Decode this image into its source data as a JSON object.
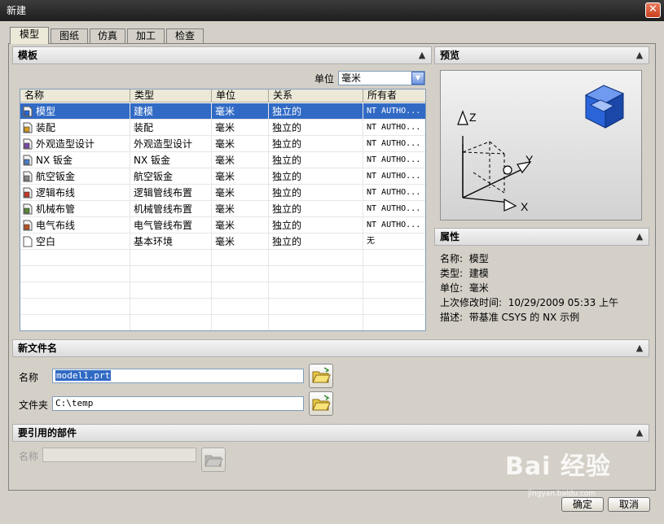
{
  "window": {
    "title": "新建",
    "close_symbol": "✕"
  },
  "tabs": [
    {
      "label": "模型",
      "active": true
    },
    {
      "label": "图纸",
      "active": false
    },
    {
      "label": "仿真",
      "active": false
    },
    {
      "label": "加工",
      "active": false
    },
    {
      "label": "检查",
      "active": false
    }
  ],
  "template": {
    "header": "模板",
    "unit_label": "单位",
    "unit_value": "毫米",
    "columns": [
      "名称",
      "类型",
      "单位",
      "关系",
      "所有者"
    ],
    "rows": [
      {
        "name": "模型",
        "type": "建模",
        "unit": "毫米",
        "relation": "独立的",
        "owner": "NT AUTHO...",
        "icon": "model-icon",
        "selected": true
      },
      {
        "name": "装配",
        "type": "装配",
        "unit": "毫米",
        "relation": "独立的",
        "owner": "NT AUTHO...",
        "icon": "assembly-icon",
        "selected": false
      },
      {
        "name": "外观造型设计",
        "type": "外观造型设计",
        "unit": "毫米",
        "relation": "独立的",
        "owner": "NT AUTHO...",
        "icon": "shape-studio-icon",
        "selected": false
      },
      {
        "name": "NX 钣金",
        "type": "NX 钣金",
        "unit": "毫米",
        "relation": "独立的",
        "owner": "NT AUTHO...",
        "icon": "sheet-metal-icon",
        "selected": false
      },
      {
        "name": "航空钣金",
        "type": "航空钣金",
        "unit": "毫米",
        "relation": "独立的",
        "owner": "NT AUTHO...",
        "icon": "aero-sheet-metal-icon",
        "selected": false
      },
      {
        "name": "逻辑布线",
        "type": "逻辑管线布置",
        "unit": "毫米",
        "relation": "独立的",
        "owner": "NT AUTHO...",
        "icon": "logical-routing-icon",
        "selected": false
      },
      {
        "name": "机械布管",
        "type": "机械管线布置",
        "unit": "毫米",
        "relation": "独立的",
        "owner": "NT AUTHO...",
        "icon": "mechanical-routing-icon",
        "selected": false
      },
      {
        "name": "电气布线",
        "type": "电气管线布置",
        "unit": "毫米",
        "relation": "独立的",
        "owner": "NT AUTHO...",
        "icon": "electrical-routing-icon",
        "selected": false
      },
      {
        "name": "空白",
        "type": "基本环境",
        "unit": "毫米",
        "relation": "独立的",
        "owner": "无",
        "icon": "blank-icon",
        "selected": false
      }
    ]
  },
  "preview": {
    "header": "预览",
    "axis_z": "Z",
    "axis_y": "Y",
    "axis_x": "X"
  },
  "properties": {
    "header": "属性",
    "name_label": "名称:",
    "name_value": "模型",
    "type_label": "类型:",
    "type_value": "建模",
    "unit_label": "单位:",
    "unit_value": "毫米",
    "modified_label": "上次修改时间:",
    "modified_value": "10/29/2009 05:33 上午",
    "desc_label": "描述:",
    "desc_value": "带基准 CSYS 的 NX 示例"
  },
  "new_file": {
    "header": "新文件名",
    "name_label": "名称",
    "name_value": "model1.prt",
    "folder_label": "文件夹",
    "folder_value": "C:\\temp"
  },
  "reference_part": {
    "header": "要引用的部件",
    "name_label": "名称",
    "name_value": ""
  },
  "buttons": {
    "ok": "确定",
    "cancel": "取消"
  },
  "watermark": {
    "brand": "Bai 经验",
    "url": "jingyan.baidu.com"
  },
  "colors": {
    "selection": "#316ac5",
    "title_bar": "#2b2b2b",
    "cube": "#2a64d8"
  }
}
